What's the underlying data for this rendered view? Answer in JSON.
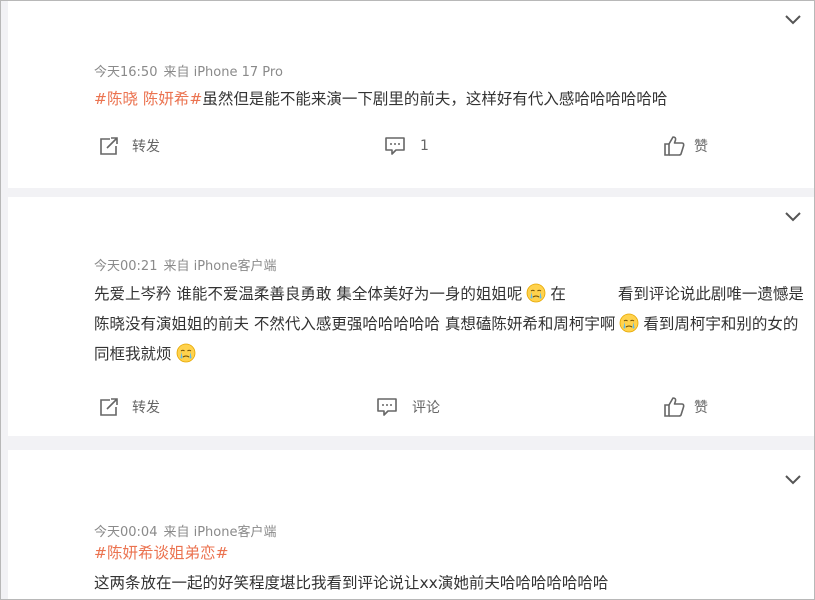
{
  "posts": [
    {
      "time": "今天16:50",
      "source": "来自 iPhone 17 Pro",
      "topic": "#陈晓 陈妍希#",
      "text": "虽然但是能不能来演一下剧里的前夫，这样好有代入感哈哈哈哈哈哈",
      "repost_label": "转发",
      "comment_label": "1",
      "like_label": "赞"
    },
    {
      "time": "今天00:21",
      "source": "来自 iPhone客户端",
      "text_part1": "先爱上岑矜 谁能不爱温柔善良勇敢 集全体美好为一身的姐姐呢",
      "text_part2": "在",
      "text_part3": "看到评论说此剧唯一遗憾是陈晓没有演姐姐的前夫 不然代入感更强哈哈哈哈哈 真想磕陈妍希和周柯宇啊",
      "text_part4": "看到周柯宇和别的女的同框我就烦",
      "repost_label": "转发",
      "comment_label": "评论",
      "like_label": "赞"
    },
    {
      "time": "今天00:04",
      "source": "来自 iPhone客户端",
      "topic": "#陈妍希谈姐弟恋#",
      "text": "这两条放在一起的好笑程度堪比我看到评论说让xx演她前夫哈哈哈哈哈哈哈"
    }
  ],
  "colors": {
    "topic": "#eb7350",
    "meta": "#8a8a8a",
    "action": "#666666",
    "background": "#f2f2f5"
  },
  "icons": [
    "chevron-down-icon",
    "repost-icon",
    "comment-icon",
    "like-icon",
    "crying-emoji-icon"
  ]
}
